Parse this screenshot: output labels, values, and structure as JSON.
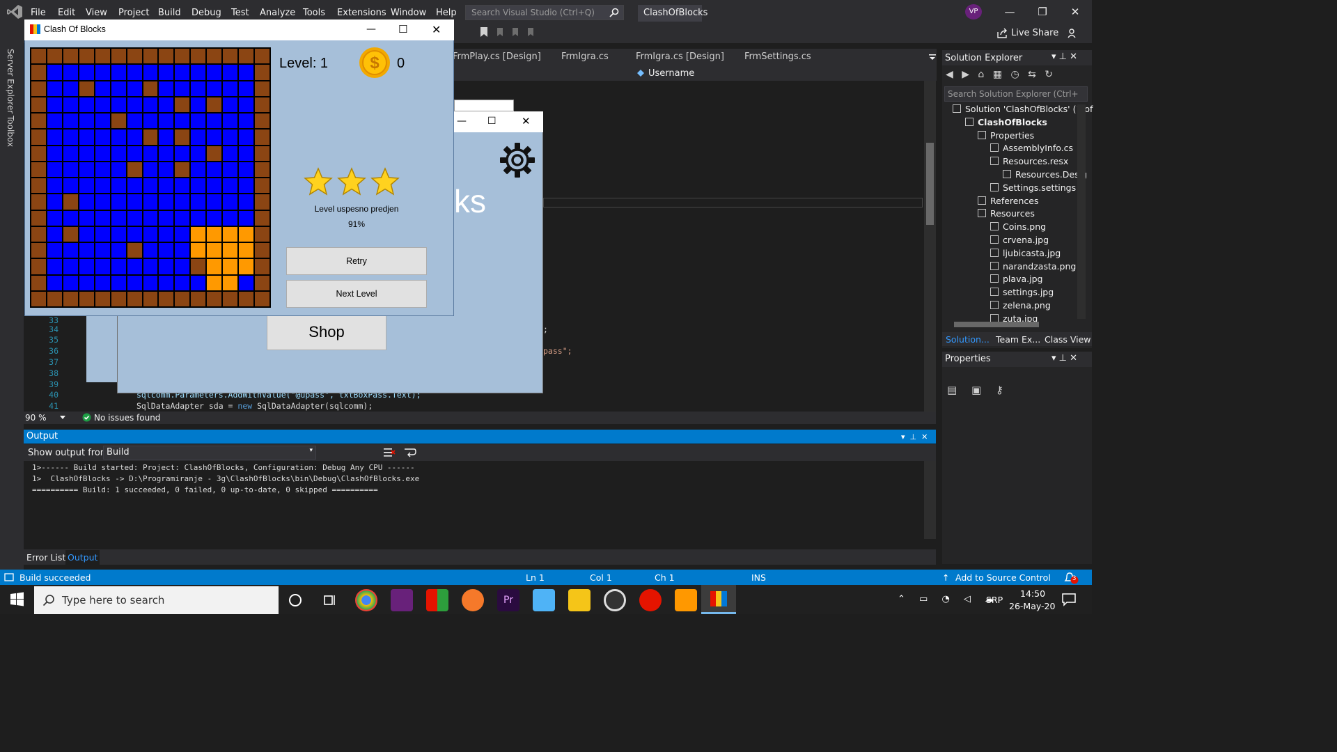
{
  "vs": {
    "menu": [
      "File",
      "Edit",
      "View",
      "Project",
      "Build",
      "Debug",
      "Test",
      "Analyze",
      "Tools",
      "Extensions",
      "Window",
      "Help"
    ],
    "search_placeholder": "Search Visual Studio (Ctrl+Q)",
    "project_title": "ClashOfBlocks",
    "avatar_initials": "VP",
    "live_share": "Live Share",
    "side_tabs": [
      "Server Explorer",
      "Toolbox"
    ],
    "doc_tabs": [
      "FrmPlay.cs [Design]",
      "FrmIgra.cs",
      "FrmIgra.cs [Design]",
      "FrmSettings.cs"
    ],
    "nav_member": "Username",
    "zoom": "90 %",
    "issues": "No issues found",
    "line_numbers": [
      "33",
      "34",
      "35",
      "36",
      "37",
      "38",
      "39",
      "40",
      "41"
    ],
    "code_line_40": "sqlcomm.Parameters.AddWithValue(\"@upass\", txtBoxPass.Text);",
    "code_line_41_a": "SqlDataAdapter sda = ",
    "code_line_41_kw": "new",
    "code_line_41_b": " SqlDataAdapter(sqlcomm);",
    "code_frag_1": ";",
    "code_frag_2": "pass\";"
  },
  "output": {
    "title": "Output",
    "show_from_label": "Show output from:",
    "source": "Build",
    "lines": [
      "1>------ Build started: Project: ClashOfBlocks, Configuration: Debug Any CPU ------",
      "1>  ClashOfBlocks -> D:\\Programiranje - 3g\\ClashOfBlocks\\bin\\Debug\\ClashOfBlocks.exe",
      "========== Build: 1 succeeded, 0 failed, 0 up-to-date, 0 skipped =========="
    ],
    "tabs": [
      "Error List",
      "Output"
    ]
  },
  "solution": {
    "title": "Solution Explorer",
    "search_placeholder": "Search Solution Explorer (Ctrl+",
    "items": [
      {
        "label": "Solution 'ClashOfBlocks' (1 of",
        "depth": 0
      },
      {
        "label": "ClashOfBlocks",
        "depth": 1
      },
      {
        "label": "Properties",
        "depth": 2
      },
      {
        "label": "AssemblyInfo.cs",
        "depth": 3
      },
      {
        "label": "Resources.resx",
        "depth": 3
      },
      {
        "label": "Resources.Desig",
        "depth": 4
      },
      {
        "label": "Settings.settings",
        "depth": 3
      },
      {
        "label": "References",
        "depth": 2
      },
      {
        "label": "Resources",
        "depth": 2
      },
      {
        "label": "Coins.png",
        "depth": 3
      },
      {
        "label": "crvena.jpg",
        "depth": 3
      },
      {
        "label": "ljubicasta.jpg",
        "depth": 3
      },
      {
        "label": "narandzasta.png",
        "depth": 3
      },
      {
        "label": "plava.jpg",
        "depth": 3
      },
      {
        "label": "settings.jpg",
        "depth": 3
      },
      {
        "label": "zelena.png",
        "depth": 3
      },
      {
        "label": "zuta.jpg",
        "depth": 3
      }
    ],
    "bottom_tabs": [
      "Solution...",
      "Team Ex...",
      "Class View"
    ],
    "properties_title": "Properties"
  },
  "status": {
    "build": "Build succeeded",
    "ln": "Ln 1",
    "col": "Col 1",
    "ch": "Ch 1",
    "ins": "INS",
    "source_control": "Add to Source Control",
    "notif_count": "3"
  },
  "taskbar": {
    "search_placeholder": "Type here to search",
    "lang": "SRP",
    "time": "14:50",
    "date": "26-May-20"
  },
  "menu_form": {
    "title_fragment": "ks",
    "shop_label": "Shop"
  },
  "game": {
    "title": "Clash Of Blocks",
    "level_label": "Level: 1",
    "coins": "0",
    "stars": 3,
    "result_text": "Level uspesno predjen",
    "result_percent": "91%",
    "retry_label": "Retry",
    "next_label": "Next Level",
    "colors": {
      "B": "#0000ff",
      "W": "#8b4513",
      "O": "#ff9900",
      "R": "#8b4513"
    },
    "grid": [
      "WWWWWWWWWWWWWWW",
      "WBBBBBBBBBBBBBW",
      "WBBWBBBWBBBBBBW",
      "WBBBBBBBBWBWBBW",
      "WBBBBWBBBBBBBBW",
      "WBBBBBBWBWBBBBW",
      "WBBBBBBBBBBWBBW",
      "WBBBBBWBBWBBBBW",
      "WBBBBBBBBBBBBBW",
      "WBWBBBBBBBBBBBW",
      "WBBBBBBBBBBBBBW",
      "WBWBBBBBBBOOOOW",
      "WBBBBBWBBBOOOOW",
      "WBBBBBBBBBWOOOW",
      "WBBBBBBBBBBOOBW",
      "WWWWWWWWWWWWWWW"
    ]
  }
}
